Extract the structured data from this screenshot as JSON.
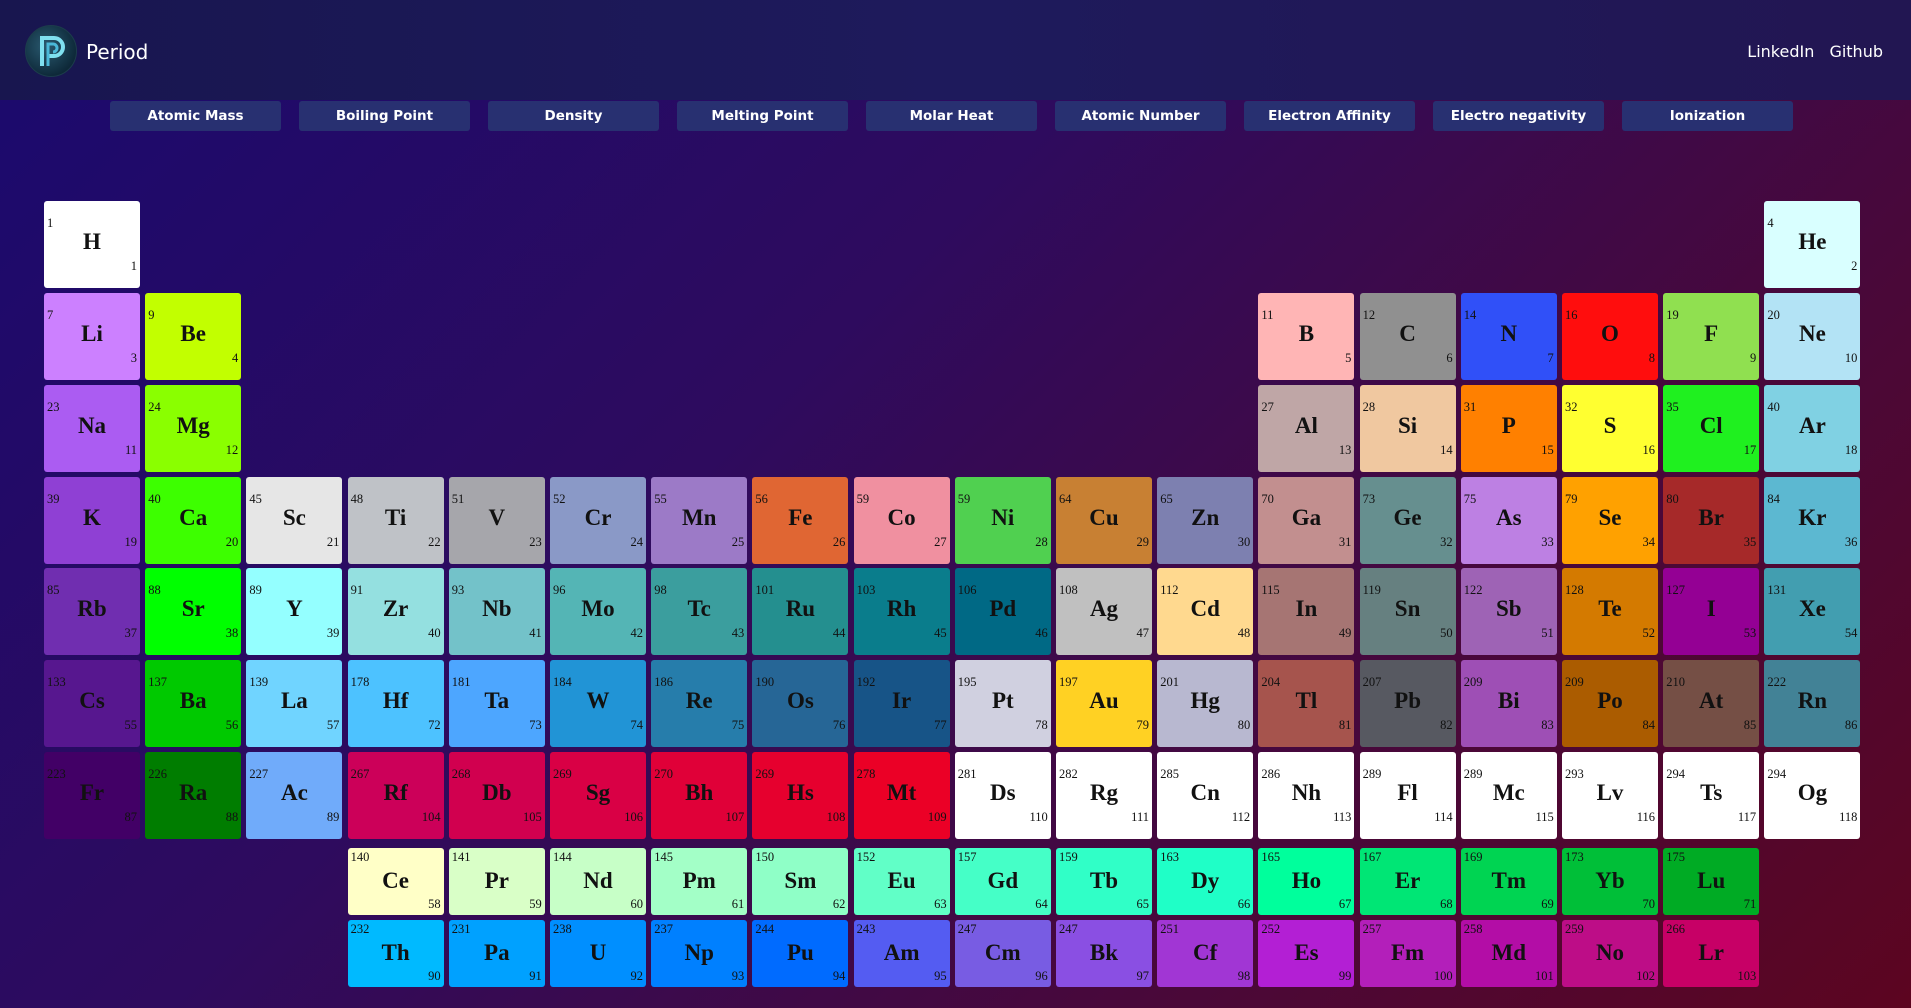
{
  "header": {
    "brand": "Period",
    "links": [
      "LinkedIn",
      "Github"
    ]
  },
  "properties": [
    "Atomic Mass",
    "Boiling Point",
    "Density",
    "Melting Point",
    "Molar Heat",
    "Atomic Number",
    "Electron Affinity",
    "Electro negativity",
    "Ionization"
  ],
  "elements": [
    {
      "s": "H",
      "n": 1,
      "m": "1",
      "c": "#ffffff",
      "r": 1,
      "g": 1
    },
    {
      "s": "He",
      "n": 2,
      "m": "4",
      "c": "#d9ffff",
      "r": 1,
      "g": 18
    },
    {
      "s": "Li",
      "n": 3,
      "m": "7",
      "c": "#cc80ff",
      "r": 2,
      "g": 1
    },
    {
      "s": "Be",
      "n": 4,
      "m": "9",
      "c": "#c2ff00",
      "r": 2,
      "g": 2
    },
    {
      "s": "B",
      "n": 5,
      "m": "11",
      "c": "#ffb5b5",
      "r": 2,
      "g": 13
    },
    {
      "s": "C",
      "n": 6,
      "m": "12",
      "c": "#909090",
      "r": 2,
      "g": 14
    },
    {
      "s": "N",
      "n": 7,
      "m": "14",
      "c": "#3050f8",
      "r": 2,
      "g": 15
    },
    {
      "s": "O",
      "n": 8,
      "m": "16",
      "c": "#ff0d0d",
      "r": 2,
      "g": 16
    },
    {
      "s": "F",
      "n": 9,
      "m": "19",
      "c": "#90e050",
      "r": 2,
      "g": 17
    },
    {
      "s": "Ne",
      "n": 10,
      "m": "20",
      "c": "#b3e3f5",
      "r": 2,
      "g": 18
    },
    {
      "s": "Na",
      "n": 11,
      "m": "23",
      "c": "#ab5cf2",
      "r": 3,
      "g": 1
    },
    {
      "s": "Mg",
      "n": 12,
      "m": "24",
      "c": "#8aff00",
      "r": 3,
      "g": 2
    },
    {
      "s": "Al",
      "n": 13,
      "m": "27",
      "c": "#bfa6a6",
      "r": 3,
      "g": 13
    },
    {
      "s": "Si",
      "n": 14,
      "m": "28",
      "c": "#f0c8a0",
      "r": 3,
      "g": 14
    },
    {
      "s": "P",
      "n": 15,
      "m": "31",
      "c": "#ff8000",
      "r": 3,
      "g": 15
    },
    {
      "s": "S",
      "n": 16,
      "m": "32",
      "c": "#ffff30",
      "r": 3,
      "g": 16
    },
    {
      "s": "Cl",
      "n": 17,
      "m": "35",
      "c": "#1ff01f",
      "r": 3,
      "g": 17
    },
    {
      "s": "Ar",
      "n": 18,
      "m": "40",
      "c": "#80d1e3",
      "r": 3,
      "g": 18
    },
    {
      "s": "K",
      "n": 19,
      "m": "39",
      "c": "#8f40d4",
      "r": 4,
      "g": 1
    },
    {
      "s": "Ca",
      "n": 20,
      "m": "40",
      "c": "#3dff00",
      "r": 4,
      "g": 2
    },
    {
      "s": "Sc",
      "n": 21,
      "m": "45",
      "c": "#e6e6e6",
      "r": 4,
      "g": 3
    },
    {
      "s": "Ti",
      "n": 22,
      "m": "48",
      "c": "#bfc2c7",
      "r": 4,
      "g": 4
    },
    {
      "s": "V",
      "n": 23,
      "m": "51",
      "c": "#a6a6ab",
      "r": 4,
      "g": 5
    },
    {
      "s": "Cr",
      "n": 24,
      "m": "52",
      "c": "#8a99c7",
      "r": 4,
      "g": 6
    },
    {
      "s": "Mn",
      "n": 25,
      "m": "55",
      "c": "#9c7ac7",
      "r": 4,
      "g": 7
    },
    {
      "s": "Fe",
      "n": 26,
      "m": "56",
      "c": "#e06633",
      "r": 4,
      "g": 8
    },
    {
      "s": "Co",
      "n": 27,
      "m": "59",
      "c": "#f090a0",
      "r": 4,
      "g": 9
    },
    {
      "s": "Ni",
      "n": 28,
      "m": "59",
      "c": "#50d050",
      "r": 4,
      "g": 10
    },
    {
      "s": "Cu",
      "n": 29,
      "m": "64",
      "c": "#c88033",
      "r": 4,
      "g": 11
    },
    {
      "s": "Zn",
      "n": 30,
      "m": "65",
      "c": "#7d80b0",
      "r": 4,
      "g": 12
    },
    {
      "s": "Ga",
      "n": 31,
      "m": "70",
      "c": "#c28f8f",
      "r": 4,
      "g": 13
    },
    {
      "s": "Ge",
      "n": 32,
      "m": "73",
      "c": "#668f8f",
      "r": 4,
      "g": 14
    },
    {
      "s": "As",
      "n": 33,
      "m": "75",
      "c": "#bd80e3",
      "r": 4,
      "g": 15
    },
    {
      "s": "Se",
      "n": 34,
      "m": "79",
      "c": "#ffa100",
      "r": 4,
      "g": 16
    },
    {
      "s": "Br",
      "n": 35,
      "m": "80",
      "c": "#a62929",
      "r": 4,
      "g": 17
    },
    {
      "s": "Kr",
      "n": 36,
      "m": "84",
      "c": "#5cb8d1",
      "r": 4,
      "g": 18
    },
    {
      "s": "Rb",
      "n": 37,
      "m": "85",
      "c": "#702eb0",
      "r": 5,
      "g": 1
    },
    {
      "s": "Sr",
      "n": 38,
      "m": "88",
      "c": "#00ff00",
      "r": 5,
      "g": 2
    },
    {
      "s": "Y",
      "n": 39,
      "m": "89",
      "c": "#94ffff",
      "r": 5,
      "g": 3
    },
    {
      "s": "Zr",
      "n": 40,
      "m": "91",
      "c": "#94e0e0",
      "r": 5,
      "g": 4
    },
    {
      "s": "Nb",
      "n": 41,
      "m": "93",
      "c": "#73c2c9",
      "r": 5,
      "g": 5
    },
    {
      "s": "Mo",
      "n": 42,
      "m": "96",
      "c": "#54b5b5",
      "r": 5,
      "g": 6
    },
    {
      "s": "Tc",
      "n": 43,
      "m": "98",
      "c": "#3b9e9e",
      "r": 5,
      "g": 7
    },
    {
      "s": "Ru",
      "n": 44,
      "m": "101",
      "c": "#248f8f",
      "r": 5,
      "g": 8
    },
    {
      "s": "Rh",
      "n": 45,
      "m": "103",
      "c": "#0a7d8c",
      "r": 5,
      "g": 9
    },
    {
      "s": "Pd",
      "n": 46,
      "m": "106",
      "c": "#006985",
      "r": 5,
      "g": 10
    },
    {
      "s": "Ag",
      "n": 47,
      "m": "108",
      "c": "#c0c0c0",
      "r": 5,
      "g": 11
    },
    {
      "s": "Cd",
      "n": 48,
      "m": "112",
      "c": "#ffd98f",
      "r": 5,
      "g": 12
    },
    {
      "s": "In",
      "n": 49,
      "m": "115",
      "c": "#a67573",
      "r": 5,
      "g": 13
    },
    {
      "s": "Sn",
      "n": 50,
      "m": "119",
      "c": "#668080",
      "r": 5,
      "g": 14
    },
    {
      "s": "Sb",
      "n": 51,
      "m": "122",
      "c": "#9e63b5",
      "r": 5,
      "g": 15
    },
    {
      "s": "Te",
      "n": 52,
      "m": "128",
      "c": "#d47a00",
      "r": 5,
      "g": 16
    },
    {
      "s": "I",
      "n": 53,
      "m": "127",
      "c": "#940094",
      "r": 5,
      "g": 17
    },
    {
      "s": "Xe",
      "n": 54,
      "m": "131",
      "c": "#429eb0",
      "r": 5,
      "g": 18
    },
    {
      "s": "Cs",
      "n": 55,
      "m": "133",
      "c": "#57178f",
      "r": 6,
      "g": 1
    },
    {
      "s": "Ba",
      "n": 56,
      "m": "137",
      "c": "#00c900",
      "r": 6,
      "g": 2
    },
    {
      "s": "La",
      "n": 57,
      "m": "139",
      "c": "#70d4ff",
      "r": 6,
      "g": 3
    },
    {
      "s": "Hf",
      "n": 72,
      "m": "178",
      "c": "#4dc2ff",
      "r": 6,
      "g": 4
    },
    {
      "s": "Ta",
      "n": 73,
      "m": "181",
      "c": "#4da6ff",
      "r": 6,
      "g": 5
    },
    {
      "s": "W",
      "n": 74,
      "m": "184",
      "c": "#2194d6",
      "r": 6,
      "g": 6
    },
    {
      "s": "Re",
      "n": 75,
      "m": "186",
      "c": "#267dab",
      "r": 6,
      "g": 7
    },
    {
      "s": "Os",
      "n": 76,
      "m": "190",
      "c": "#266696",
      "r": 6,
      "g": 8
    },
    {
      "s": "Ir",
      "n": 77,
      "m": "192",
      "c": "#175487",
      "r": 6,
      "g": 9
    },
    {
      "s": "Pt",
      "n": 78,
      "m": "195",
      "c": "#d0d0e0",
      "r": 6,
      "g": 10
    },
    {
      "s": "Au",
      "n": 79,
      "m": "197",
      "c": "#ffd123",
      "r": 6,
      "g": 11
    },
    {
      "s": "Hg",
      "n": 80,
      "m": "201",
      "c": "#b8b8d0",
      "r": 6,
      "g": 12
    },
    {
      "s": "Tl",
      "n": 81,
      "m": "204",
      "c": "#a6544d",
      "r": 6,
      "g": 13
    },
    {
      "s": "Pb",
      "n": 82,
      "m": "207",
      "c": "#575961",
      "r": 6,
      "g": 14
    },
    {
      "s": "Bi",
      "n": 83,
      "m": "209",
      "c": "#9e4fb5",
      "r": 6,
      "g": 15
    },
    {
      "s": "Po",
      "n": 84,
      "m": "209",
      "c": "#ab5c00",
      "r": 6,
      "g": 16
    },
    {
      "s": "At",
      "n": 85,
      "m": "210",
      "c": "#754f45",
      "r": 6,
      "g": 17
    },
    {
      "s": "Rn",
      "n": 86,
      "m": "222",
      "c": "#428296",
      "r": 6,
      "g": 18
    },
    {
      "s": "Fr",
      "n": 87,
      "m": "223",
      "c": "#420066",
      "r": 7,
      "g": 1
    },
    {
      "s": "Ra",
      "n": 88,
      "m": "226",
      "c": "#007d00",
      "r": 7,
      "g": 2
    },
    {
      "s": "Ac",
      "n": 89,
      "m": "227",
      "c": "#70abfa",
      "r": 7,
      "g": 3
    },
    {
      "s": "Rf",
      "n": 104,
      "m": "267",
      "c": "#cc0059",
      "r": 7,
      "g": 4
    },
    {
      "s": "Db",
      "n": 105,
      "m": "268",
      "c": "#d1004f",
      "r": 7,
      "g": 5
    },
    {
      "s": "Sg",
      "n": 106,
      "m": "269",
      "c": "#d90045",
      "r": 7,
      "g": 6
    },
    {
      "s": "Bh",
      "n": 107,
      "m": "270",
      "c": "#e00038",
      "r": 7,
      "g": 7
    },
    {
      "s": "Hs",
      "n": 108,
      "m": "269",
      "c": "#e6002e",
      "r": 7,
      "g": 8
    },
    {
      "s": "Mt",
      "n": 109,
      "m": "278",
      "c": "#eb0026",
      "r": 7,
      "g": 9
    },
    {
      "s": "Ds",
      "n": 110,
      "m": "281",
      "c": "#ffffff",
      "r": 7,
      "g": 10
    },
    {
      "s": "Rg",
      "n": 111,
      "m": "282",
      "c": "#ffffff",
      "r": 7,
      "g": 11
    },
    {
      "s": "Cn",
      "n": 112,
      "m": "285",
      "c": "#ffffff",
      "r": 7,
      "g": 12
    },
    {
      "s": "Nh",
      "n": 113,
      "m": "286",
      "c": "#ffffff",
      "r": 7,
      "g": 13
    },
    {
      "s": "Fl",
      "n": 114,
      "m": "289",
      "c": "#ffffff",
      "r": 7,
      "g": 14
    },
    {
      "s": "Mc",
      "n": 115,
      "m": "289",
      "c": "#ffffff",
      "r": 7,
      "g": 15
    },
    {
      "s": "Lv",
      "n": 116,
      "m": "293",
      "c": "#ffffff",
      "r": 7,
      "g": 16
    },
    {
      "s": "Ts",
      "n": 117,
      "m": "294",
      "c": "#ffffff",
      "r": 7,
      "g": 17
    },
    {
      "s": "Og",
      "n": 118,
      "m": "294",
      "c": "#ffffff",
      "r": 7,
      "g": 18
    },
    {
      "s": "Ce",
      "n": 58,
      "m": "140",
      "c": "#ffffc7",
      "r": 8,
      "g": 4
    },
    {
      "s": "Pr",
      "n": 59,
      "m": "141",
      "c": "#d9ffc7",
      "r": 8,
      "g": 5
    },
    {
      "s": "Nd",
      "n": 60,
      "m": "144",
      "c": "#c7ffc7",
      "r": 8,
      "g": 6
    },
    {
      "s": "Pm",
      "n": 61,
      "m": "145",
      "c": "#a3ffc7",
      "r": 8,
      "g": 7
    },
    {
      "s": "Sm",
      "n": 62,
      "m": "150",
      "c": "#8fffc7",
      "r": 8,
      "g": 8
    },
    {
      "s": "Eu",
      "n": 63,
      "m": "152",
      "c": "#61ffc7",
      "r": 8,
      "g": 9
    },
    {
      "s": "Gd",
      "n": 64,
      "m": "157",
      "c": "#45ffc7",
      "r": 8,
      "g": 10
    },
    {
      "s": "Tb",
      "n": 65,
      "m": "159",
      "c": "#30ffc7",
      "r": 8,
      "g": 11
    },
    {
      "s": "Dy",
      "n": 66,
      "m": "163",
      "c": "#1fffc7",
      "r": 8,
      "g": 12
    },
    {
      "s": "Ho",
      "n": 67,
      "m": "165",
      "c": "#00ff9c",
      "r": 8,
      "g": 13
    },
    {
      "s": "Er",
      "n": 68,
      "m": "167",
      "c": "#00e675",
      "r": 8,
      "g": 14
    },
    {
      "s": "Tm",
      "n": 69,
      "m": "169",
      "c": "#00d452",
      "r": 8,
      "g": 15
    },
    {
      "s": "Yb",
      "n": 70,
      "m": "173",
      "c": "#00bf38",
      "r": 8,
      "g": 16
    },
    {
      "s": "Lu",
      "n": 71,
      "m": "175",
      "c": "#00ab24",
      "r": 8,
      "g": 17
    },
    {
      "s": "Th",
      "n": 90,
      "m": "232",
      "c": "#00baff",
      "r": 9,
      "g": 4
    },
    {
      "s": "Pa",
      "n": 91,
      "m": "231",
      "c": "#00a1ff",
      "r": 9,
      "g": 5
    },
    {
      "s": "U",
      "n": 92,
      "m": "238",
      "c": "#008fff",
      "r": 9,
      "g": 6
    },
    {
      "s": "Np",
      "n": 93,
      "m": "237",
      "c": "#0080ff",
      "r": 9,
      "g": 7
    },
    {
      "s": "Pu",
      "n": 94,
      "m": "244",
      "c": "#006bff",
      "r": 9,
      "g": 8
    },
    {
      "s": "Am",
      "n": 95,
      "m": "243",
      "c": "#545cf2",
      "r": 9,
      "g": 9
    },
    {
      "s": "Cm",
      "n": 96,
      "m": "247",
      "c": "#785ce3",
      "r": 9,
      "g": 10
    },
    {
      "s": "Bk",
      "n": 97,
      "m": "247",
      "c": "#8a4fe3",
      "r": 9,
      "g": 11
    },
    {
      "s": "Cf",
      "n": 98,
      "m": "251",
      "c": "#a136d4",
      "r": 9,
      "g": 12
    },
    {
      "s": "Es",
      "n": 99,
      "m": "252",
      "c": "#b31fd4",
      "r": 9,
      "g": 13
    },
    {
      "s": "Fm",
      "n": 100,
      "m": "257",
      "c": "#b31fba",
      "r": 9,
      "g": 14
    },
    {
      "s": "Md",
      "n": 101,
      "m": "258",
      "c": "#b30da6",
      "r": 9,
      "g": 15
    },
    {
      "s": "No",
      "n": 102,
      "m": "259",
      "c": "#bd0d87",
      "r": 9,
      "g": 16
    },
    {
      "s": "Lr",
      "n": 103,
      "m": "266",
      "c": "#c70066",
      "r": 9,
      "g": 17
    }
  ]
}
